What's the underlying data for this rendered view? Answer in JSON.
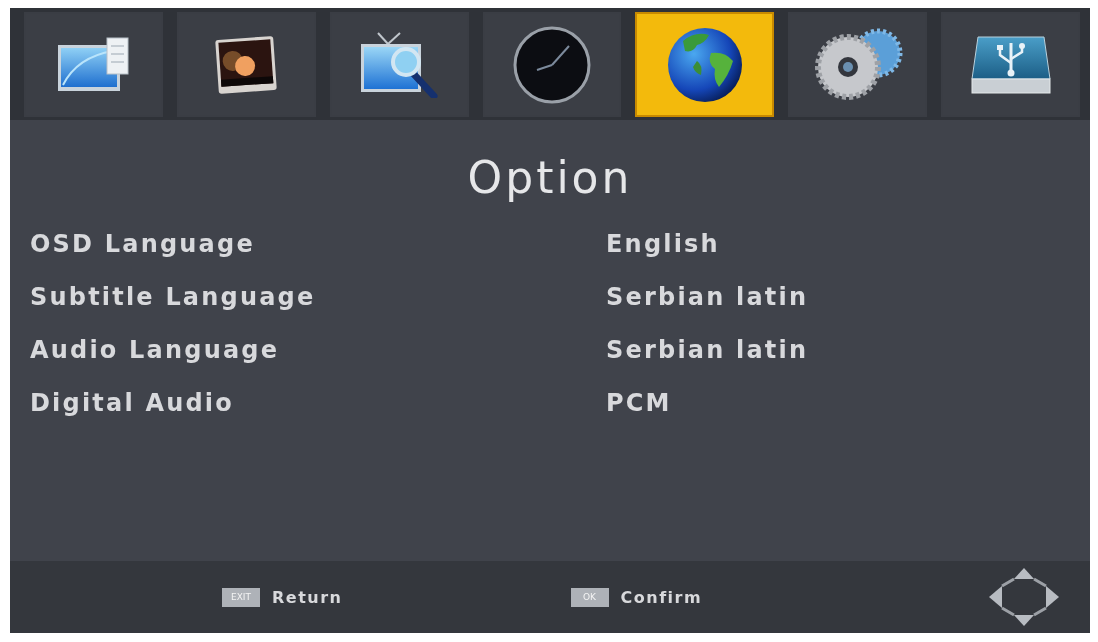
{
  "tabs": [
    {
      "kind": "monitor",
      "selected": false
    },
    {
      "kind": "photo",
      "selected": false
    },
    {
      "kind": "tv-search",
      "selected": false
    },
    {
      "kind": "clock",
      "selected": false
    },
    {
      "kind": "globe",
      "selected": true
    },
    {
      "kind": "gears",
      "selected": false
    },
    {
      "kind": "usb",
      "selected": false
    }
  ],
  "title": "Option",
  "settings": [
    {
      "label": "OSD Language",
      "value": "English"
    },
    {
      "label": "Subtitle Language",
      "value": "Serbian latin"
    },
    {
      "label": "Audio Language",
      "value": "Serbian latin"
    },
    {
      "label": "Digital Audio",
      "value": "PCM"
    }
  ],
  "footer": {
    "hints": [
      {
        "key": "EXIT",
        "label": "Return"
      },
      {
        "key": "OK",
        "label": "Confirm"
      }
    ]
  }
}
